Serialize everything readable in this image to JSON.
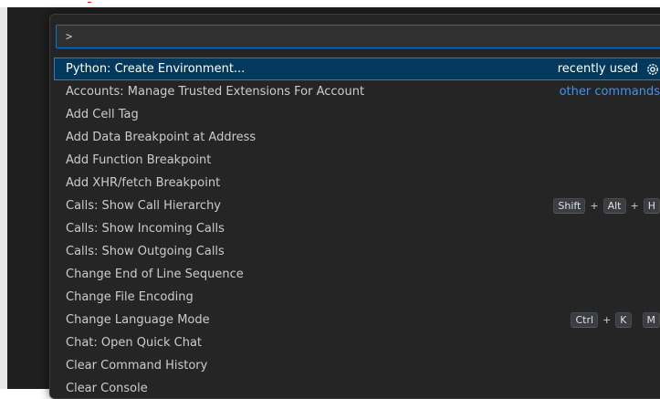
{
  "palette": {
    "input_value": ">",
    "items": [
      {
        "label": "Python: Create Environment...",
        "tag": "recently used",
        "selected": true
      },
      {
        "label": "Accounts: Manage Trusted Extensions For Account",
        "tag": "other commands"
      },
      {
        "label": "Add Cell Tag"
      },
      {
        "label": "Add Data Breakpoint at Address"
      },
      {
        "label": "Add Function Breakpoint"
      },
      {
        "label": "Add XHR/fetch Breakpoint"
      },
      {
        "label": "Calls: Show Call Hierarchy",
        "keys": [
          "Shift",
          "Alt",
          "H"
        ]
      },
      {
        "label": "Calls: Show Incoming Calls"
      },
      {
        "label": "Calls: Show Outgoing Calls"
      },
      {
        "label": "Change End of Line Sequence"
      },
      {
        "label": "Change File Encoding"
      },
      {
        "label": "Change Language Mode",
        "keys": [
          "Ctrl",
          "K"
        ],
        "chord": [
          "M"
        ]
      },
      {
        "label": "Chat: Open Quick Chat"
      },
      {
        "label": "Clear Command History"
      },
      {
        "label": "Clear Console"
      }
    ],
    "plus": "+",
    "gear_icon": "gear-icon"
  },
  "colors": {
    "accent": "#0078d4",
    "selected_bg": "#04395e",
    "link": "#3794ff",
    "warning_red": "#e81123"
  }
}
